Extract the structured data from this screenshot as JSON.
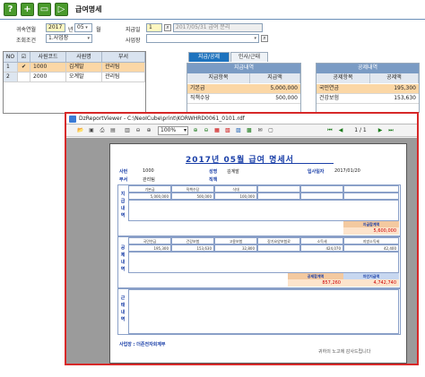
{
  "window": {
    "title": "급여명세"
  },
  "toolbar": {
    "buttons": [
      {
        "name": "help-button",
        "glyph": "?"
      },
      {
        "name": "add-button",
        "glyph": "+"
      },
      {
        "name": "screen-button",
        "glyph": "▭"
      },
      {
        "name": "play-button",
        "glyph": "▷"
      }
    ]
  },
  "filters": {
    "year_month_label": "귀속연월",
    "year": "2017",
    "year_unit": "년",
    "month": "05",
    "month_unit": "월",
    "pay_date_label": "지급일",
    "pay_seq": "1",
    "pay_desc": "2017/05/31 급여 분리",
    "condition_label": "조회조건",
    "condition_value": "1.사업장",
    "workplace_label": "사업장"
  },
  "employee_grid": {
    "headers": [
      "NO",
      "",
      "사원코드",
      "사원명",
      "부서"
    ],
    "rows": [
      {
        "no": "1",
        "checked": "✔",
        "code": "1000",
        "name": "김계발",
        "dept": "관리팀"
      },
      {
        "no": "2",
        "checked": "",
        "code": "2000",
        "name": "오계발",
        "dept": "관리팀"
      }
    ]
  },
  "tabs": [
    {
      "label": "지급/공제"
    },
    {
      "label": "인사/근태"
    }
  ],
  "payment": {
    "section_title": "지급내역",
    "col_item": "지급항목",
    "col_amount": "지급액",
    "rows": [
      {
        "item": "기본급",
        "amount": "5,000,000"
      },
      {
        "item": "직책수당",
        "amount": "500,000"
      }
    ]
  },
  "deduction": {
    "section_title": "공제내역",
    "col_item": "공제항목",
    "col_amount": "공제액",
    "rows": [
      {
        "item": "국민연금",
        "amount": "195,300"
      },
      {
        "item": "건강보험",
        "amount": "153,630"
      }
    ]
  },
  "viewer": {
    "title": "DzReportViewer - C:\\NeoICube\\print\\KORWHRD0061_0101.rdf",
    "zoom": "100%",
    "page": "1 / 1"
  },
  "report": {
    "title": "2017년 05월 급여 명세서",
    "emp_no_label": "사번",
    "emp_no": "1000",
    "name_label": "성명",
    "name": "김계발",
    "hire_label": "입사일자",
    "hire_date": "2017/01/20",
    "dept_label": "부서",
    "dept": "관리팀",
    "title_label": "직책",
    "side_pay": "지급내역",
    "side_deduct": "공제내역",
    "side_attend": "근태내역",
    "pay_items": [
      "기본급",
      "직책수당",
      "식대"
    ],
    "pay_values": [
      "5,000,000",
      "500,000",
      "100,000"
    ],
    "pay_total_label": "지급합계액",
    "pay_total": "5,600,000",
    "deduct_items": [
      "국민연금",
      "건강보험",
      "고용보험",
      "장기요양보험료",
      "소득세",
      "지방소득세"
    ],
    "deduct_values": [
      "195,300",
      "153,630",
      "32,800",
      "",
      "424,070",
      "42,400"
    ],
    "deduct_total_label": "공제합계액",
    "deduct_total": "857,260",
    "net_label": "차인지급액",
    "net_pay": "4,742,740",
    "company_label": "사업장 : 더존전자회계부",
    "footer_note": "귀하의 노고에 감사드립니다"
  }
}
